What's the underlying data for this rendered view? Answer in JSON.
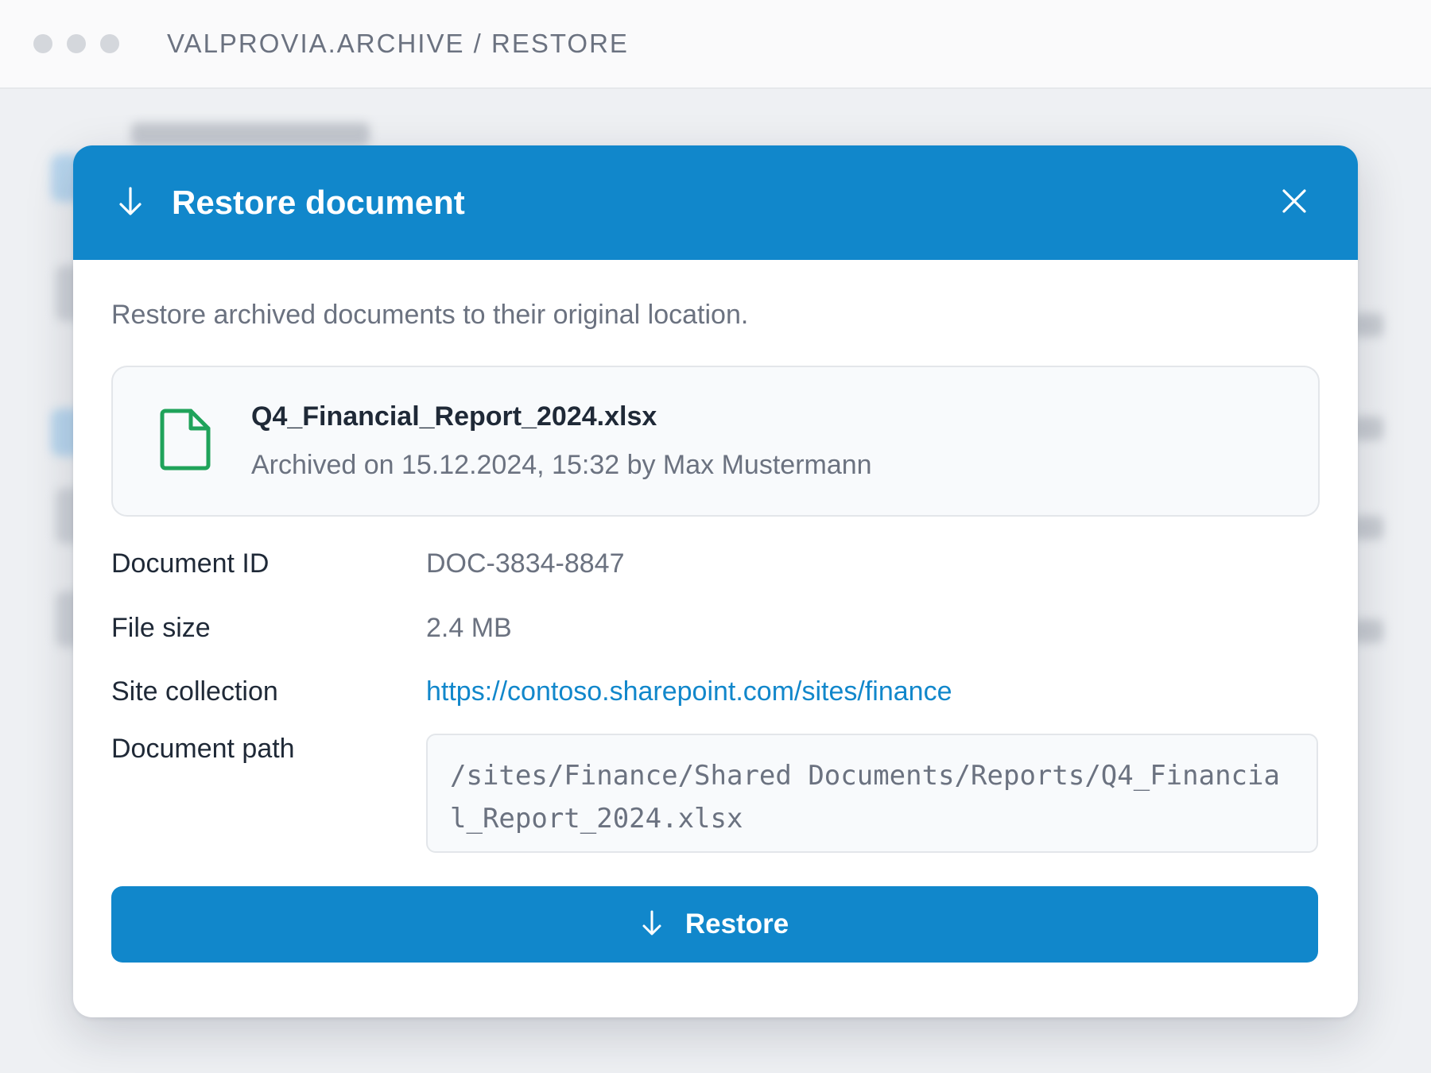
{
  "window": {
    "breadcrumb": "VALPROVIA.ARCHIVE / RESTORE"
  },
  "dialog": {
    "title": "Restore document",
    "header_icon": "arrow-down-icon",
    "close_icon": "close-icon",
    "intro": "Restore archived documents to their original location.",
    "file": {
      "icon": "file-icon",
      "name": "Q4_Financial_Report_2024.xlsx",
      "meta": "Archived on 15.12.2024, 15:32 by Max Mustermann"
    },
    "details": {
      "document_id_label": "Document ID",
      "document_id": "DOC-3834-8847",
      "file_size_label": "File size",
      "file_size": "2.4 MB",
      "site_collection_label": "Site collection",
      "site_collection": "https://contoso.sharepoint.com/sites/finance",
      "document_path_label": "Document path",
      "document_path": "/sites/Finance/Shared Documents/Reports/Q4_Financial_Report_2024.xlsx"
    },
    "restore_button": {
      "label": "Restore",
      "icon": "arrow-down-icon"
    }
  },
  "colors": {
    "accent": "#1187cb",
    "file_icon": "#1fa35a",
    "text_primary": "#1f2937",
    "text_secondary": "#6b7280"
  }
}
